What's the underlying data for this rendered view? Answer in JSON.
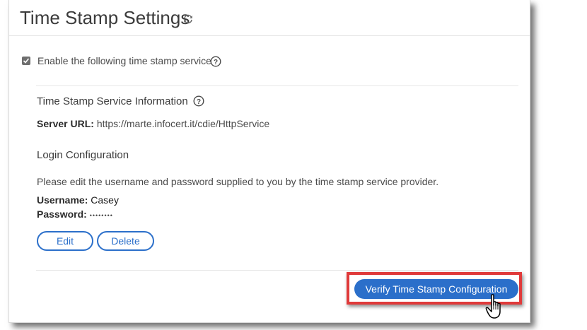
{
  "header": {
    "title": "Time Stamp Settings",
    "refresh_icon": "refresh-icon"
  },
  "enable": {
    "checked": true,
    "label": "Enable the following time stamp service",
    "help_icon": "help-icon"
  },
  "service_info": {
    "title": "Time Stamp Service Information",
    "server_url_label": "Server URL:",
    "server_url_value": "https://marte.infocert.it/cdie/HttpService"
  },
  "login": {
    "title": "Login Configuration",
    "description": "Please edit the username and password supplied to you by the time stamp service provider.",
    "username_label": "Username:",
    "username_value": "Casey",
    "password_label": "Password:",
    "password_value": "••••••••"
  },
  "buttons": {
    "edit": "Edit",
    "delete": "Delete",
    "verify": "Verify Time Stamp Configuration"
  },
  "colors": {
    "accent": "#2b6fca",
    "highlight": "#e03a3a"
  }
}
